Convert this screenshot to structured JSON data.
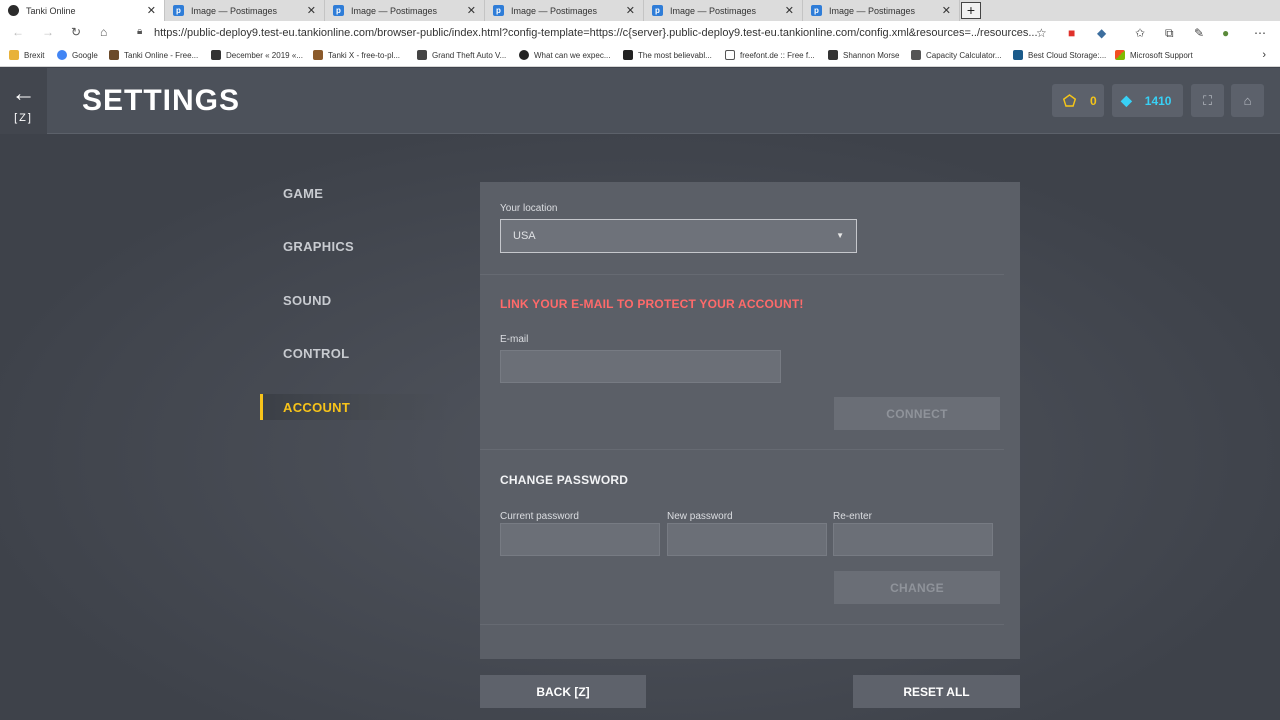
{
  "browser": {
    "tabs": [
      {
        "title": "Tanki Online",
        "icon": "tanki-icon"
      },
      {
        "title": "Image — Postimages",
        "icon": "postimages-icon"
      },
      {
        "title": "Image — Postimages",
        "icon": "postimages-icon"
      },
      {
        "title": "Image — Postimages",
        "icon": "postimages-icon"
      },
      {
        "title": "Image — Postimages",
        "icon": "postimages-icon"
      },
      {
        "title": "Image — Postimages",
        "icon": "postimages-icon"
      }
    ],
    "url": "https://public-deploy9.test-eu.tankionline.com/browser-public/index.html?config-template=https://c{server}.public-deploy9.test-eu.tankionline.com/config.xml&resources=../resources...",
    "bookmarks": [
      "Brexit",
      "Google",
      "Tanki Online - Free...",
      "December « 2019 «...",
      "Tanki X - free-to-pl...",
      "Grand Theft Auto V...",
      "What can we expec...",
      "The most believabl...",
      "freefont.de :: Free f...",
      "Shannon Morse",
      "Capacity Calculator...",
      "Best Cloud Storage:...",
      "Microsoft Support"
    ]
  },
  "header": {
    "back_key": "[Z]",
    "title": "SETTINGS",
    "crystals": "0",
    "diamonds": "1410"
  },
  "menu": {
    "items": [
      "GAME",
      "GRAPHICS",
      "SOUND",
      "CONTROL",
      "ACCOUNT"
    ],
    "active": "ACCOUNT"
  },
  "account": {
    "location_label": "Your location",
    "location_value": "USA",
    "email_warning": "LINK YOUR E-MAIL TO PROTECT YOUR ACCOUNT!",
    "email_label": "E-mail",
    "email_value": "",
    "connect_label": "CONNECT",
    "change_password_heading": "CHANGE PASSWORD",
    "current_password_label": "Current password",
    "new_password_label": "New password",
    "reenter_label": "Re-enter",
    "change_label": "CHANGE"
  },
  "footer": {
    "back_label": "BACK [Z]",
    "reset_label": "RESET ALL"
  },
  "colors": {
    "accent_yellow": "#f7c31a",
    "warning_red": "#ff6a6a",
    "diamond_cyan": "#38d0f5"
  }
}
